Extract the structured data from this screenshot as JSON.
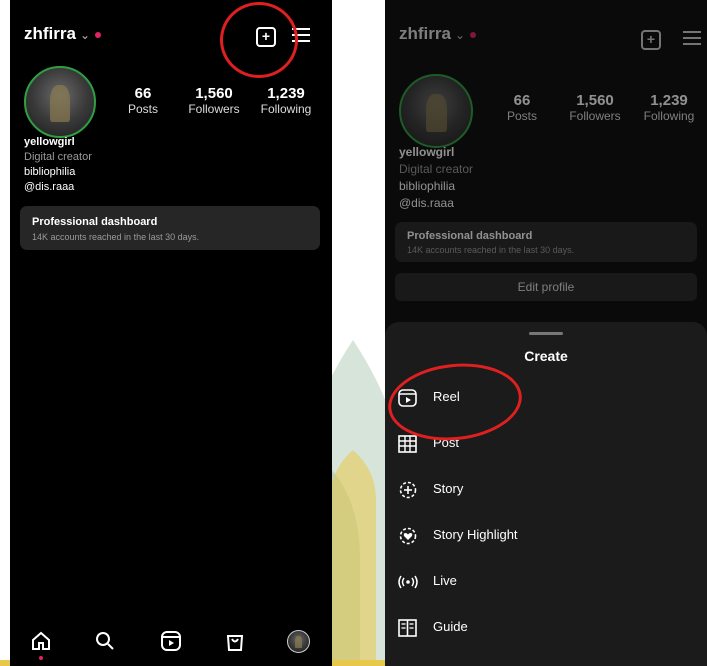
{
  "left": {
    "username": "zhfirra",
    "stats": [
      {
        "value": "66",
        "label": "Posts"
      },
      {
        "value": "1,560",
        "label": "Followers"
      },
      {
        "value": "1,239",
        "label": "Following"
      }
    ],
    "bio": {
      "name": "yellowgirl",
      "category": "Digital creator",
      "line": "bibliophilia",
      "handle": "@dis.raaa"
    },
    "dashboard": {
      "title": "Professional dashboard",
      "subtitle": "14K accounts reached in the last 30 days."
    }
  },
  "right": {
    "username": "zhfirra",
    "stats": [
      {
        "value": "66",
        "label": "Posts"
      },
      {
        "value": "1,560",
        "label": "Followers"
      },
      {
        "value": "1,239",
        "label": "Following"
      }
    ],
    "bio": {
      "name": "yellowgirl",
      "category": "Digital creator",
      "line": "bibliophilia",
      "handle": "@dis.raaa"
    },
    "dashboard": {
      "title": "Professional dashboard",
      "subtitle": "14K accounts reached in the last 30 days."
    },
    "edit_profile": "Edit profile",
    "sheet": {
      "title": "Create",
      "items": [
        {
          "icon": "reel-icon",
          "label": "Reel"
        },
        {
          "icon": "grid-icon",
          "label": "Post"
        },
        {
          "icon": "story-plus-icon",
          "label": "Story"
        },
        {
          "icon": "heart-circle-icon",
          "label": "Story Highlight"
        },
        {
          "icon": "live-icon",
          "label": "Live"
        },
        {
          "icon": "guide-icon",
          "label": "Guide"
        }
      ]
    }
  },
  "colors": {
    "annotation": "#e02020",
    "avatar_ring": "#2ea043",
    "watermark": "#1f6b2a",
    "stripe": "#e8c84a"
  }
}
